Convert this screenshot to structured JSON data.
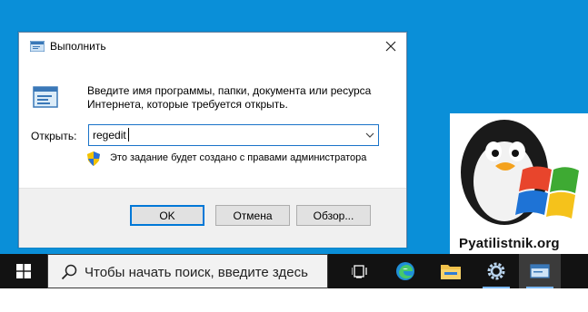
{
  "dialog": {
    "title": "Выполнить",
    "description": "Введите имя программы, папки, документа или ресурса Интернета, которые требуется открыть.",
    "open_label": "Открыть:",
    "open_value": "regedit",
    "admin_note": "Это задание будет создано с правами администратора",
    "buttons": {
      "ok": "OK",
      "cancel": "Отмена",
      "browse": "Обзор..."
    }
  },
  "logo": {
    "text": "Pyatilistnik.org"
  },
  "taskbar": {
    "search_placeholder": "Чтобы начать поиск, введите здесь",
    "items": [
      "task-view",
      "edge",
      "file-explorer",
      "settings",
      "run"
    ]
  },
  "colors": {
    "desktop": "#0a8fd8",
    "accent": "#0078d7",
    "taskbar": "#121212"
  }
}
